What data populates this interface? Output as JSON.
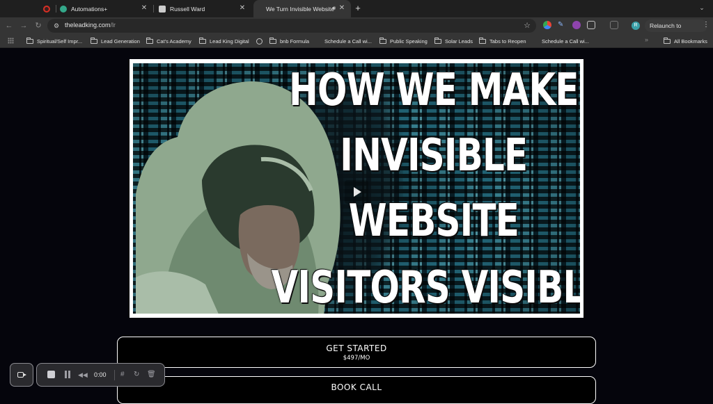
{
  "browser": {
    "tabs": [
      {
        "title": "",
        "favicon_color": "#d93025",
        "active": false
      },
      {
        "title": "Automations+",
        "favicon_color": "#34a88a",
        "active": false
      },
      {
        "title": "Russell Ward",
        "favicon_color": "#cccccc",
        "active": false
      },
      {
        "title": "We Turn Invisible Website",
        "favicon_color": "",
        "active": true,
        "audio": true
      }
    ],
    "new_tab_label": "+",
    "address": {
      "host": "theleadking.com",
      "path": "/lr"
    },
    "relaunch_label": "Relaunch to update",
    "profile_initial": "R"
  },
  "bookmarks": [
    {
      "label": "Spiritual/Self Impr...",
      "type": "folder"
    },
    {
      "label": "Lead Generation",
      "type": "folder"
    },
    {
      "label": "Cat's Academy",
      "type": "folder"
    },
    {
      "label": "Lead King Digital",
      "type": "folder"
    },
    {
      "label": "",
      "type": "globe"
    },
    {
      "label": "bnb Formula",
      "type": "folder"
    },
    {
      "label": "Schedule a Call wi...",
      "type": "link"
    },
    {
      "label": "Public Speaking",
      "type": "folder"
    },
    {
      "label": "Solar Leads",
      "type": "folder"
    },
    {
      "label": "Tabs to Reopen",
      "type": "folder"
    },
    {
      "label": "Schedule a Call wi...",
      "type": "link"
    },
    {
      "label": "All Bookmarks",
      "type": "folder"
    }
  ],
  "video": {
    "headline_lines": [
      "HOW WE MAKE",
      "INVISIBLE",
      "WEBSITE",
      "VISITORS VISIBLE"
    ]
  },
  "cta": {
    "primary_title": "GET STARTED",
    "primary_sub": "$497/MO",
    "secondary_title": "BOOK CALL"
  },
  "recorder": {
    "time": "0:00"
  }
}
